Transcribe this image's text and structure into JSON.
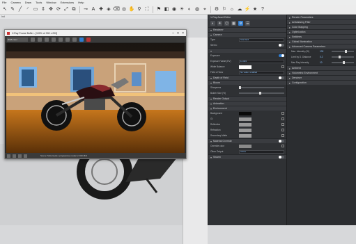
{
  "menubar": {
    "items": [
      "File",
      "Camera",
      "Draw",
      "Tools",
      "Window",
      "Extensions",
      "Help"
    ]
  },
  "toolbar": {
    "icons": [
      "select-icon",
      "pencil-icon",
      "line-icon",
      "arc-icon",
      "rectangle-icon",
      "push-pull-icon",
      "move-icon",
      "rotate-icon",
      "scale-icon",
      "offset-icon",
      "tape-icon",
      "text-icon",
      "axes-icon",
      "paint-icon",
      "eraser-icon",
      "orbit-icon",
      "pan-icon",
      "zoom-icon",
      "zoom-extents-icon",
      "walk-icon",
      "section-icon",
      "render-icon",
      "light-icon",
      "material-icon",
      "environment-icon",
      "camera-icon",
      "settings-icon",
      "flag-icon",
      "sun-icon",
      "cloud-icon",
      "bolt-icon",
      "star-icon",
      "help-icon"
    ]
  },
  "statusline": {
    "text": "Ind"
  },
  "viewer": {
    "title": "V-Ray Frame Buffer - [100% of 300 x 200]",
    "channel_field": "RGB color",
    "status_text": "Scene: Motorcycle | progressive render | 0:00:18.3"
  },
  "panel1": {
    "header": "V-Ray Asset Editor",
    "tabs": [
      "materials-tab-icon",
      "lights-tab-icon",
      "geometry-tab-icon",
      "textures-tab-icon",
      "render-tab-icon",
      "settings-tab-icon"
    ],
    "sections": [
      {
        "title": "Renderer",
        "rows": []
      },
      {
        "title": "Camera",
        "rows": [
          {
            "label": "Type",
            "kind": "field",
            "value": "Standard"
          },
          {
            "label": "Stereo",
            "kind": "toggle",
            "on": false
          }
        ]
      },
      {
        "title": "",
        "rows": [
          {
            "label": "Exposure",
            "kind": "toggle",
            "on": true
          },
          {
            "label": "Exposure Value (EV)",
            "kind": "field",
            "value": "11.323"
          },
          {
            "label": "White Balance",
            "kind": "swatch",
            "color": "#ffffff"
          },
          {
            "label": "Field of View",
            "kind": "field",
            "value": "No value: enabled"
          }
        ]
      },
      {
        "title": "Depth of Field",
        "toggle": false,
        "rows": []
      },
      {
        "title": "Bloom",
        "rows": [
          {
            "label": "Sharpness",
            "kind": "slider",
            "value": 0
          },
          {
            "label": "Bokeh Size (%)",
            "kind": "slider",
            "value": 0.45
          }
        ]
      },
      {
        "title": "Render Output",
        "rows": []
      },
      {
        "title": "Animation",
        "rows": []
      },
      {
        "title": "Environment",
        "rows": [
          {
            "label": "Background",
            "kind": "swatch",
            "color": "#0a0a0a"
          },
          {
            "label": "GI",
            "kind": "swatch",
            "color": "#9a9a9a"
          },
          {
            "label": "Reflection",
            "kind": "swatch",
            "color": "#9a9a9a"
          },
          {
            "label": "Refraction",
            "kind": "swatch",
            "color": "#9a9a9a"
          },
          {
            "label": "Secondary Matte",
            "kind": "swatch",
            "color": "#9a9a9a"
          }
        ]
      },
      {
        "title": "Material Override",
        "toggle": false,
        "rows": [
          {
            "label": "Override color",
            "kind": "swatch",
            "color": "#8a8a8a"
          },
          {
            "label": "Other Output",
            "kind": "field",
            "value": "Active"
          }
        ]
      },
      {
        "title": "Swarm",
        "toggle": false,
        "rows": []
      }
    ]
  },
  "panel2": {
    "sections": [
      {
        "title": "Render Parameters",
        "rows": []
      },
      {
        "title": "Antialiasing Filter",
        "rows": []
      },
      {
        "title": "Color Mapping",
        "rows": []
      },
      {
        "title": "Optimization",
        "rows": []
      },
      {
        "title": "Switches",
        "rows": []
      },
      {
        "title": "Global Illumination",
        "rows": []
      },
      {
        "title": "Advanced Camera Parameters",
        "rows": [
          {
            "label": "Max. Intensity (GI)",
            "value": "100",
            "slider": 0.6
          },
          {
            "label": "Limit by D. Distance",
            "value": "0.2",
            "slider": 0.3
          },
          {
            "label": "Max Ray Intensity",
            "value": "10",
            "slider": 0.5
          }
        ]
      },
      {
        "title": "Ambient",
        "rows": []
      },
      {
        "title": "Volumetric Environment",
        "rows": []
      },
      {
        "title": "Denoiser",
        "rows": []
      },
      {
        "title": "Configuration",
        "rows": []
      }
    ]
  }
}
